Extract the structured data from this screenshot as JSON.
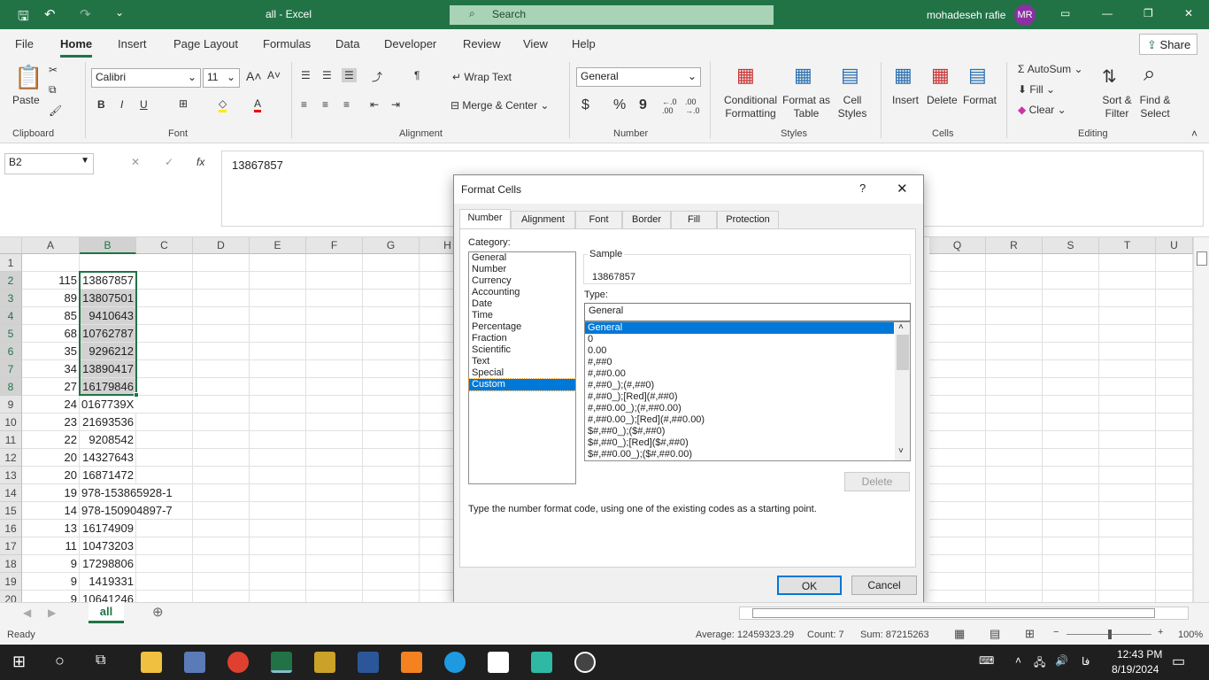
{
  "titlebar": {
    "file_title": "all  -  Excel",
    "search_placeholder": "Search",
    "user_name": "mohadeseh rafie",
    "user_initials": "MR"
  },
  "menu": {
    "tabs": [
      "File",
      "Home",
      "Insert",
      "Page Layout",
      "Formulas",
      "Data",
      "Developer",
      "Review",
      "View",
      "Help"
    ],
    "share": "Share"
  },
  "ribbon": {
    "clipboard": {
      "paste": "Paste",
      "label": "Clipboard"
    },
    "font": {
      "name": "Calibri",
      "size": "11",
      "bold": "B",
      "italic": "I",
      "underline": "U",
      "label": "Font"
    },
    "alignment": {
      "wrap": "Wrap Text",
      "merge": "Merge & Center",
      "label": "Alignment"
    },
    "number": {
      "format": "General",
      "currency": "$",
      "percent": "%",
      "comma": "9",
      "label": "Number"
    },
    "styles": {
      "conditional": "Conditional Formatting",
      "format_table": "Format as Table",
      "cell_styles": "Cell Styles",
      "label": "Styles"
    },
    "cells": {
      "insert": "Insert",
      "delete": "Delete",
      "format": "Format",
      "label": "Cells"
    },
    "editing": {
      "autosum": "AutoSum",
      "fill": "Fill",
      "clear": "Clear",
      "sort": "Sort & Filter",
      "find": "Find & Select",
      "label": "Editing"
    }
  },
  "formula_bar": {
    "name_box": "B2",
    "fx": "fx",
    "value": "13867857"
  },
  "sheet": {
    "columns": [
      "A",
      "B",
      "C",
      "D",
      "E",
      "F",
      "G",
      "H",
      "Q",
      "R",
      "S",
      "T",
      "U"
    ],
    "rows": [
      {
        "n": "1",
        "a": "",
        "b": ""
      },
      {
        "n": "2",
        "a": "115",
        "b": "13867857"
      },
      {
        "n": "3",
        "a": "89",
        "b": "13807501"
      },
      {
        "n": "4",
        "a": "85",
        "b": "9410643"
      },
      {
        "n": "5",
        "a": "68",
        "b": "10762787"
      },
      {
        "n": "6",
        "a": "35",
        "b": "9296212"
      },
      {
        "n": "7",
        "a": "34",
        "b": "13890417"
      },
      {
        "n": "8",
        "a": "27",
        "b": "16179846"
      },
      {
        "n": "9",
        "a": "24",
        "b": "0167739X"
      },
      {
        "n": "10",
        "a": "23",
        "b": "21693536"
      },
      {
        "n": "11",
        "a": "22",
        "b": "9208542"
      },
      {
        "n": "12",
        "a": "20",
        "b": "14327643"
      },
      {
        "n": "13",
        "a": "20",
        "b": "16871472"
      },
      {
        "n": "14",
        "a": "19",
        "b": "978-153865928-1"
      },
      {
        "n": "15",
        "a": "14",
        "b": "978-150904897-7"
      },
      {
        "n": "16",
        "a": "13",
        "b": "16174909"
      },
      {
        "n": "17",
        "a": "11",
        "b": "10473203"
      },
      {
        "n": "18",
        "a": "9",
        "b": "17298806"
      },
      {
        "n": "19",
        "a": "9",
        "b": "1419331"
      },
      {
        "n": "20",
        "a": "9",
        "b": "10641246"
      }
    ],
    "tab": "all"
  },
  "dialog": {
    "title": "Format Cells",
    "help": "?",
    "close": "✕",
    "tabs": [
      "Number",
      "Alignment",
      "Font",
      "Border",
      "Fill",
      "Protection"
    ],
    "category_label": "Category:",
    "categories": [
      "General",
      "Number",
      "Currency",
      "Accounting",
      "Date",
      "Time",
      "Percentage",
      "Fraction",
      "Scientific",
      "Text",
      "Special",
      "Custom"
    ],
    "selected_category": "Custom",
    "sample_label": "Sample",
    "sample_value": "13867857",
    "type_label": "Type:",
    "type_value": "General",
    "types": [
      "General",
      "0",
      "0.00",
      "#,##0",
      "#,##0.00",
      "#,##0_);(#,##0)",
      "#,##0_);[Red](#,##0)",
      "#,##0.00_);(#,##0.00)",
      "#,##0.00_);[Red](#,##0.00)",
      "$#,##0_);($#,##0)",
      "$#,##0_);[Red]($#,##0)",
      "$#,##0.00_);($#,##0.00)"
    ],
    "delete": "Delete",
    "hint": "Type the number format code, using one of the existing codes as a starting point.",
    "ok": "OK",
    "cancel": "Cancel"
  },
  "status": {
    "ready": "Ready",
    "average": "Average: 12459323.29",
    "count": "Count: 7",
    "sum": "Sum: 87215263",
    "zoom": "100%"
  },
  "taskbar": {
    "lang": "فا",
    "time": "12:43 PM",
    "date": "8/19/2024"
  },
  "colors": {
    "excel_green": "#217346",
    "selection": "#0078d7"
  }
}
